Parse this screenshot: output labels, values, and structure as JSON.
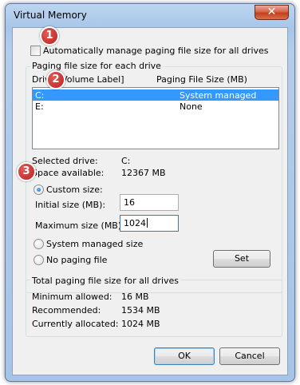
{
  "window": {
    "title": "Virtual Memory",
    "close_glyph": "✕"
  },
  "auto_manage": {
    "label": "Automatically manage paging file size for all drives",
    "checked": false
  },
  "drives_group": {
    "title": "Paging file size for each drive",
    "col_drive": "Drive [Volume Label]",
    "col_size": "Paging File Size (MB)",
    "rows": [
      {
        "drive": "C:",
        "size": "System managed",
        "selected": true
      },
      {
        "drive": "E:",
        "size": "None",
        "selected": false
      }
    ],
    "selected_drive_label": "Selected drive:",
    "selected_drive_value": "C:",
    "space_label": "Space available:",
    "space_value": "12367 MB",
    "custom_size_label": "Custom size:",
    "initial_label": "Initial size (MB):",
    "initial_value": "16",
    "maximum_label": "Maximum size (MB):",
    "maximum_value": "1024",
    "system_managed_label": "System managed size",
    "no_paging_label": "No paging file",
    "set_label": "Set",
    "selected_option": "custom"
  },
  "totals_group": {
    "title": "Total paging file size for all drives",
    "min_label": "Minimum allowed:",
    "min_value": "16 MB",
    "rec_label": "Recommended:",
    "rec_value": "1534 MB",
    "cur_label": "Currently allocated:",
    "cur_value": "1024 MB"
  },
  "buttons": {
    "ok": "OK",
    "cancel": "Cancel"
  },
  "badges": {
    "b1": "1",
    "b2": "2",
    "b3": "3"
  },
  "colors": {
    "selection": "#3399ff",
    "badge": "#c8302b",
    "title_bar": "#b4cdea"
  }
}
